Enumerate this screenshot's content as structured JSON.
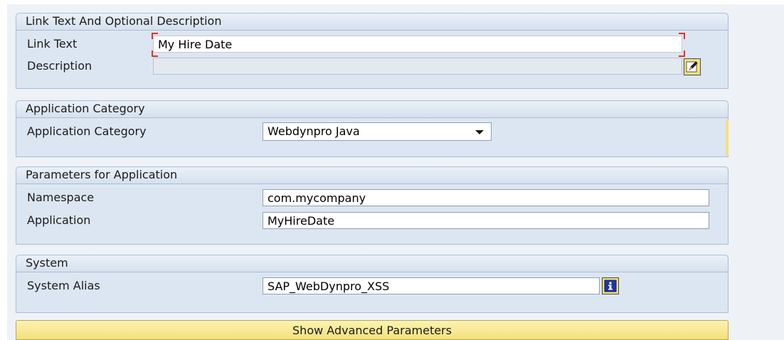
{
  "link_group": {
    "title": "Link Text And Optional Description",
    "link_text_label": "Link Text",
    "link_text_value": "My Hire Date",
    "description_label": "Description",
    "description_value": ""
  },
  "category_group": {
    "title": "Application Category",
    "category_label": "Application Category",
    "category_value": "Webdynpro Java"
  },
  "params_group": {
    "title": "Parameters for Application",
    "namespace_label": "Namespace",
    "namespace_value": "com.mycompany",
    "application_label": "Application",
    "application_value": "MyHireDate"
  },
  "system_group": {
    "title": "System",
    "alias_label": "System Alias",
    "alias_value": "SAP_WebDynpro_XSS"
  },
  "advanced_button": "Show Advanced Parameters",
  "colors": {
    "group_bg": "#dce6f2",
    "group_border": "#a9bdd6",
    "required_marker": "#e0322a",
    "button_yellow": "#f4e07c"
  },
  "icons": {
    "description_edit": "edit-pencil-icon",
    "alias_info": "info-icon"
  }
}
